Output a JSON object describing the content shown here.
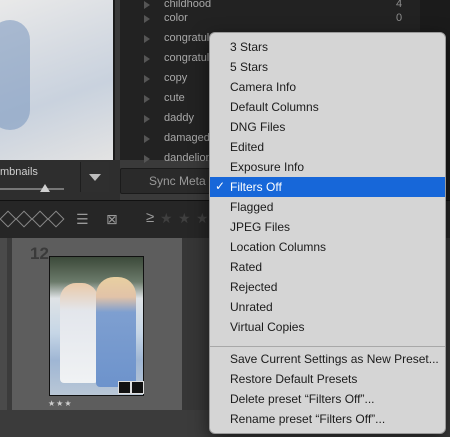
{
  "app": {
    "keywords": [
      {
        "name": "childhood",
        "count": "4"
      },
      {
        "name": "color",
        "count": "0"
      },
      {
        "name": "congratul",
        "count": ""
      },
      {
        "name": "congratul",
        "count": ""
      },
      {
        "name": "copy",
        "count": ""
      },
      {
        "name": "cute",
        "count": ""
      },
      {
        "name": "daddy",
        "count": ""
      },
      {
        "name": "damaged",
        "count": ""
      },
      {
        "name": "dandelion",
        "count": ""
      }
    ],
    "thumbnails_label": "mbnails",
    "sync_button_label": "Sync Meta",
    "toolbar_ge": "≥",
    "cell_number": "12",
    "cell_rating": "★★★",
    "icons": [
      "diamond-flag-icon",
      "compare-icon",
      "survey-icon",
      "star-icon",
      "dropdown-arrow-icon"
    ]
  },
  "menu": {
    "items": [
      {
        "label": "3 Stars",
        "checked": false
      },
      {
        "label": "5 Stars",
        "checked": false
      },
      {
        "label": "Camera Info",
        "checked": false
      },
      {
        "label": "Default Columns",
        "checked": false
      },
      {
        "label": "DNG Files",
        "checked": false
      },
      {
        "label": "Edited",
        "checked": false
      },
      {
        "label": "Exposure Info",
        "checked": false
      },
      {
        "label": "Filters Off",
        "checked": true
      },
      {
        "label": "Flagged",
        "checked": false
      },
      {
        "label": "JPEG Files",
        "checked": false
      },
      {
        "label": "Location Columns",
        "checked": false
      },
      {
        "label": "Rated",
        "checked": false
      },
      {
        "label": "Rejected",
        "checked": false
      },
      {
        "label": "Unrated",
        "checked": false
      },
      {
        "label": "Virtual Copies",
        "checked": false
      }
    ],
    "actions": [
      {
        "label": "Save Current Settings as New Preset..."
      },
      {
        "label": "Restore Default Presets"
      },
      {
        "label": "Delete preset “Filters Off”..."
      },
      {
        "label": "Rename preset “Filters Off”..."
      }
    ],
    "checkmark": "✓",
    "selected_color": "#1767d9",
    "menu_bg": "#d5d5d5"
  }
}
